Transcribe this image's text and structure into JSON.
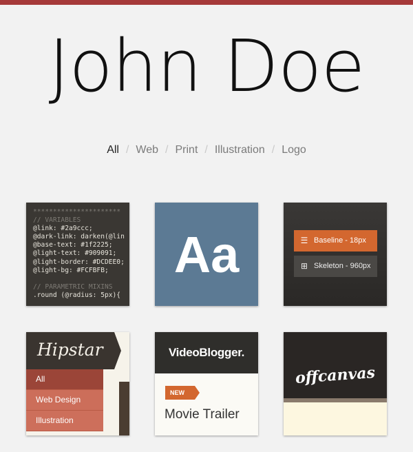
{
  "header": {
    "title": "John Doe"
  },
  "filters": {
    "items": [
      "All",
      "Web",
      "Print",
      "Illustration",
      "Logo"
    ],
    "active": "All",
    "separator": "/"
  },
  "portfolio": {
    "code_tile": {
      "lines": [
        "**********************",
        "// VARIABLES",
        "@link: #2a9ccc;",
        "@dark-link: darken(@lin",
        "@base-text: #1f2225;",
        "@light-text: #909091;",
        "@light-border: #DCDEE0;",
        "@light-bg: #FCFBFB;",
        "",
        "// PARAMETRIC MIXINS",
        ".round (@radius: 5px){"
      ]
    },
    "type_tile": {
      "text": "Aa"
    },
    "grid_tile": {
      "baseline_label": "Baseline - 18px",
      "skeleton_label": "Skeleton - 960px"
    },
    "hipstar_tile": {
      "logo": "Hipstar",
      "menu": [
        "All",
        "Web Design",
        "Illustration"
      ]
    },
    "videoblogger_tile": {
      "logo": "VideoBlogger.",
      "badge": "NEW",
      "title": "Movie Trailer"
    },
    "offcanvas_tile": {
      "logo": "offcanvas"
    }
  },
  "colors": {
    "accent_red": "#a63a3a",
    "accent_orange": "#d3672f",
    "slate_blue": "#5c7a94",
    "background": "#f2f2f2"
  }
}
